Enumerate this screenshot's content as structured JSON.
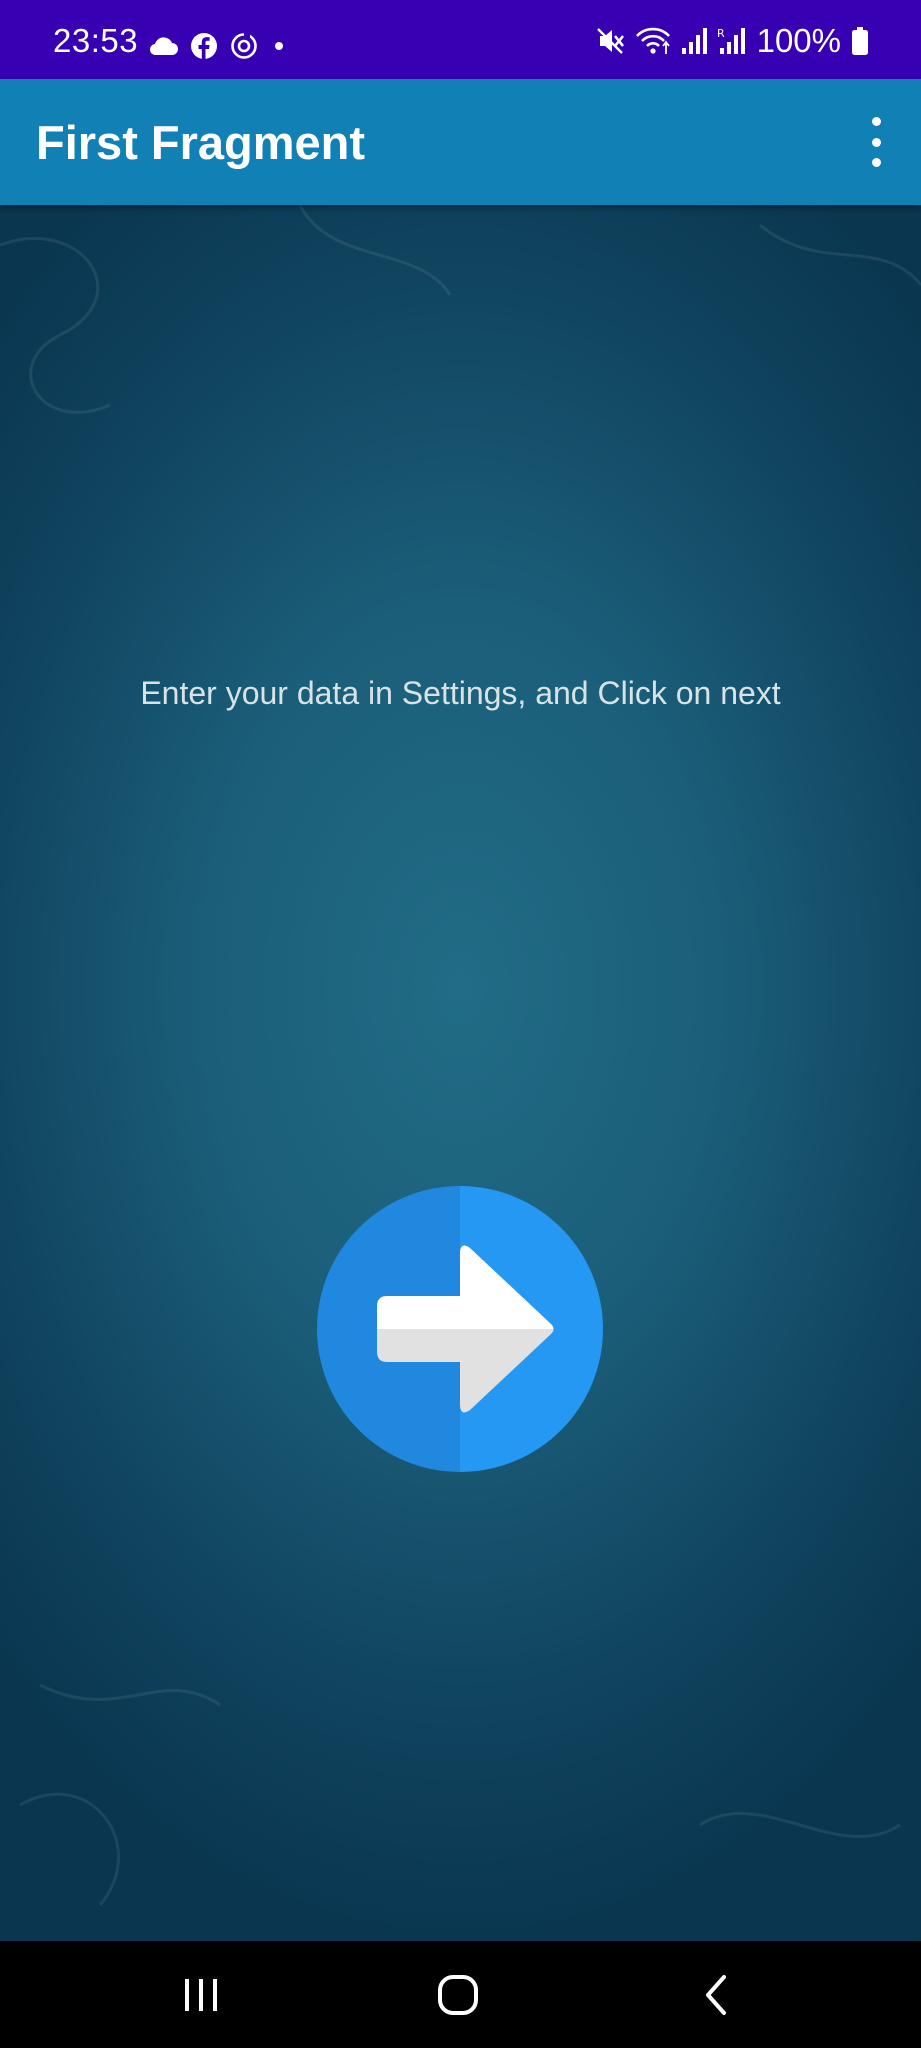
{
  "status_bar": {
    "time": "23:53",
    "left_icons": [
      "cloud-icon",
      "facebook-icon",
      "sync-icon",
      "dot-icon"
    ],
    "right_icons": [
      "mute-icon",
      "wifi-icon",
      "signal-icon",
      "signal-roaming-icon",
      "battery-icon"
    ],
    "battery": "100%",
    "colors": {
      "background": "#3700b3"
    }
  },
  "app_bar": {
    "title": "First Fragment",
    "overflow_icon": "more-vert-icon",
    "colors": {
      "background": "#1180b5"
    }
  },
  "main": {
    "message": "Enter your data in Settings, and Click on next",
    "next_button_icon": "arrow-right-circle-icon",
    "colors": {
      "button_left": "#2188df",
      "button_right": "#2598f3",
      "arrow_top": "#ffffff",
      "arrow_bottom": "#e1e1e1"
    }
  },
  "nav_bar": {
    "buttons": [
      "recents-icon",
      "home-icon",
      "back-icon"
    ]
  }
}
